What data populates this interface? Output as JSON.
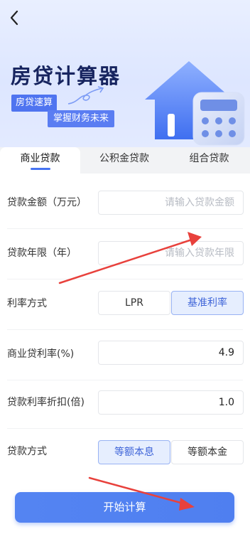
{
  "hero": {
    "title": "房贷计算器",
    "tag1": "房贷速算",
    "tag2": "掌握财务未来"
  },
  "tabs": [
    {
      "label": "商业贷款",
      "active": true
    },
    {
      "label": "公积金贷款",
      "active": false
    },
    {
      "label": "组合贷款",
      "active": false
    }
  ],
  "form": {
    "amount": {
      "label": "贷款金额（万元）",
      "placeholder": "请输入贷款金额",
      "value": ""
    },
    "years": {
      "label": "贷款年限（年）",
      "placeholder": "请输入贷款年限",
      "value": ""
    },
    "rate_mode": {
      "label": "利率方式",
      "options": [
        "LPR",
        "基准利率"
      ],
      "selected": "基准利率"
    },
    "rate": {
      "label": "商业贷利率(%)",
      "value": "4.9"
    },
    "discount": {
      "label": "贷款利率折扣(倍)",
      "value": "1.0"
    },
    "repay": {
      "label": "贷款方式",
      "options": [
        "等额本息",
        "等额本金"
      ],
      "selected": "等额本息"
    }
  },
  "submit_label": "开始计算",
  "colors": {
    "accent": "#4f7ff0",
    "arrow": "#e8413c"
  }
}
